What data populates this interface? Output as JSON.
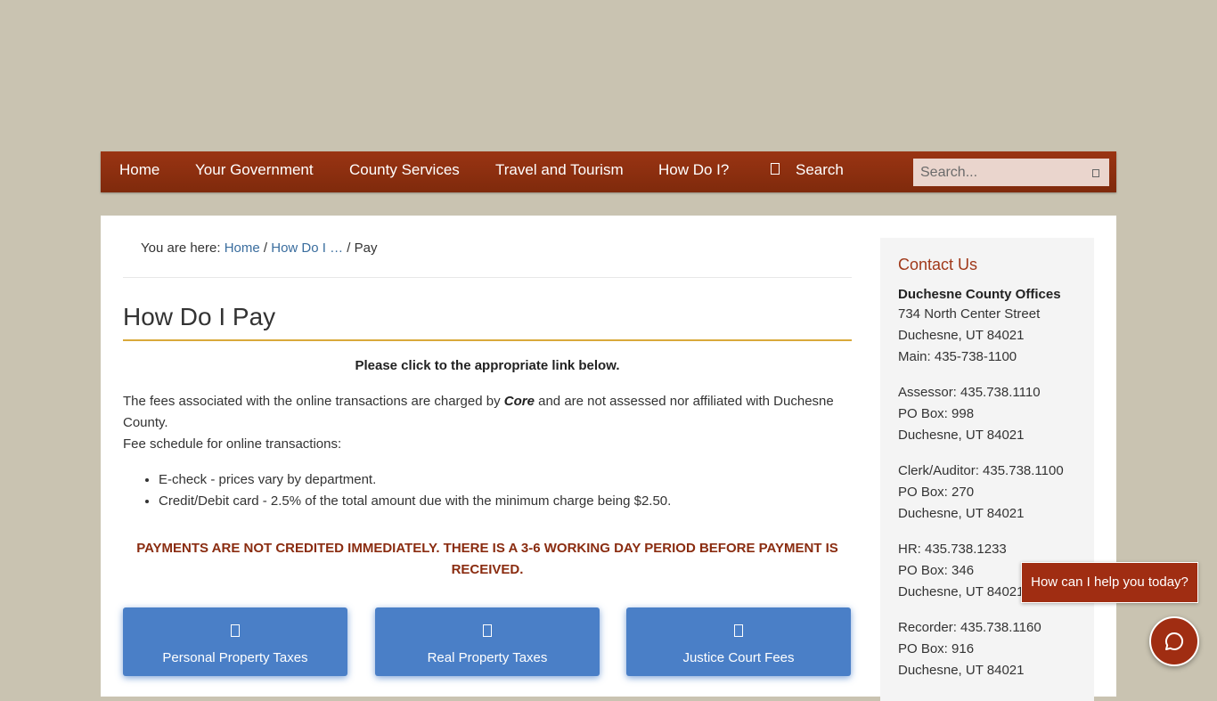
{
  "nav": {
    "items": [
      "Home",
      "Your Government",
      "County Services",
      "Travel and Tourism",
      "How Do I?"
    ],
    "search_label": "Search",
    "search_placeholder": "Search..."
  },
  "breadcrumb": {
    "prefix": "You are here:",
    "home": "Home",
    "sep1": "/",
    "how": "How Do I …",
    "sep2": "/",
    "current": "Pay"
  },
  "page": {
    "title": "How Do I Pay",
    "instruction": "Please click to the appropriate link below.",
    "fees_text_before": "The fees associated with the online transactions are charged by",
    "fees_provider": "Core",
    "fees_text_after": "and are not assessed nor affiliated with Duchesne County.",
    "fee_schedule": "Fee schedule for online transactions:",
    "fee_items": [
      "E-check - prices vary by department.",
      "Credit/Debit card - 2.5% of the total amount due with the minimum charge being $2.50."
    ],
    "warning": "PAYMENTS ARE NOT CREDITED IMMEDIATELY. THERE IS A 3-6 WORKING DAY PERIOD BEFORE PAYMENT IS RECEIVED.",
    "buttons": [
      "Personal Property Taxes",
      "Real Property Taxes",
      "Justice Court Fees"
    ]
  },
  "sidebar": {
    "title": "Contact Us",
    "office_name": "Duchesne County Offices",
    "office_lines": [
      "734 North Center Street",
      "Duchesne, UT 84021",
      "Main: 435-738-1100"
    ],
    "assessor": [
      "Assessor: 435.738.1110",
      "PO Box: 998",
      "Duchesne, UT 84021"
    ],
    "clerk": [
      "Clerk/Auditor: 435.738.1100",
      "PO Box: 270",
      "Duchesne, UT 84021"
    ],
    "hr": [
      "HR: 435.738.1233",
      "PO Box: 346",
      "Duchesne, UT 84021"
    ],
    "recorder": [
      "Recorder: 435.738.1160",
      "PO Box: 916",
      "Duchesne, UT 84021"
    ]
  },
  "chat": {
    "prompt": "How can I help you today?"
  },
  "colors": {
    "background": "#c9c3b1",
    "nav": "#8f3010",
    "accent": "#a02d12",
    "button": "#4a7fc7",
    "title_rule": "#d9a93b",
    "link": "#3a6d9e"
  }
}
